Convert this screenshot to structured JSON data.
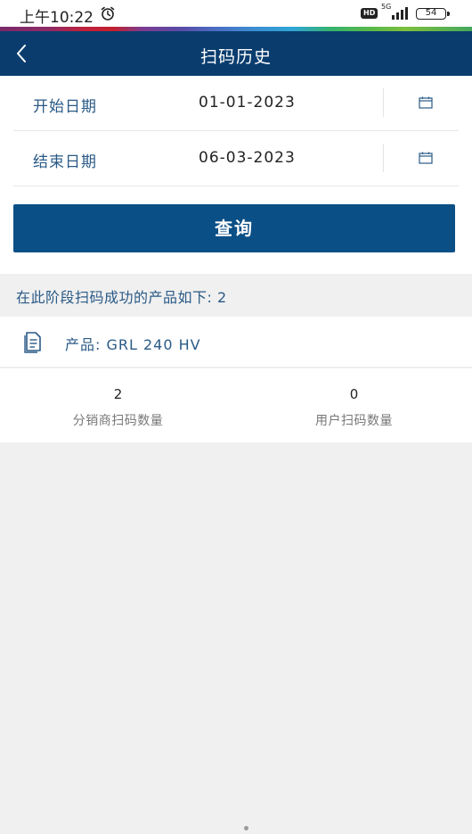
{
  "status_bar": {
    "time": "上午10:22",
    "network_badge": "HD",
    "network_type": "5G",
    "battery": "54"
  },
  "header": {
    "title": "扫码历史"
  },
  "form": {
    "start_label": "开始日期",
    "start_value": "01-01-2023",
    "end_label": "结束日期",
    "end_value": "06-03-2023"
  },
  "query_button": "查询",
  "summary": "在此阶段扫码成功的产品如下: 2",
  "product": {
    "label": "产品: GRL 240 HV"
  },
  "stats": [
    {
      "value": "2",
      "label": "分销商扫码数量"
    },
    {
      "value": "0",
      "label": "用户扫码数量"
    }
  ],
  "colors": {
    "navbar": "#0a3d6e",
    "button": "#0a4f86",
    "accent_text": "#2a5a86",
    "background": "#f0f0f0"
  },
  "icons": {
    "back": "chevron-left-icon",
    "calendar": "calendar-icon",
    "product": "document-icon",
    "alarm": "alarm-clock-icon"
  }
}
